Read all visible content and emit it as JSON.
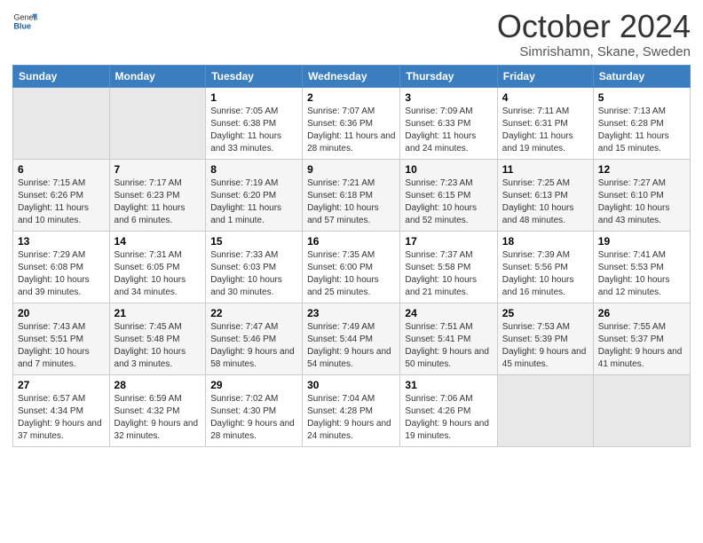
{
  "header": {
    "logo_line1": "General",
    "logo_line2": "Blue",
    "month": "October 2024",
    "location": "Simrishamn, Skane, Sweden"
  },
  "days_of_week": [
    "Sunday",
    "Monday",
    "Tuesday",
    "Wednesday",
    "Thursday",
    "Friday",
    "Saturday"
  ],
  "weeks": [
    [
      {
        "day": "",
        "sunrise": "",
        "sunset": "",
        "daylight": ""
      },
      {
        "day": "",
        "sunrise": "",
        "sunset": "",
        "daylight": ""
      },
      {
        "day": "1",
        "sunrise": "Sunrise: 7:05 AM",
        "sunset": "Sunset: 6:38 PM",
        "daylight": "Daylight: 11 hours and 33 minutes."
      },
      {
        "day": "2",
        "sunrise": "Sunrise: 7:07 AM",
        "sunset": "Sunset: 6:36 PM",
        "daylight": "Daylight: 11 hours and 28 minutes."
      },
      {
        "day": "3",
        "sunrise": "Sunrise: 7:09 AM",
        "sunset": "Sunset: 6:33 PM",
        "daylight": "Daylight: 11 hours and 24 minutes."
      },
      {
        "day": "4",
        "sunrise": "Sunrise: 7:11 AM",
        "sunset": "Sunset: 6:31 PM",
        "daylight": "Daylight: 11 hours and 19 minutes."
      },
      {
        "day": "5",
        "sunrise": "Sunrise: 7:13 AM",
        "sunset": "Sunset: 6:28 PM",
        "daylight": "Daylight: 11 hours and 15 minutes."
      }
    ],
    [
      {
        "day": "6",
        "sunrise": "Sunrise: 7:15 AM",
        "sunset": "Sunset: 6:26 PM",
        "daylight": "Daylight: 11 hours and 10 minutes."
      },
      {
        "day": "7",
        "sunrise": "Sunrise: 7:17 AM",
        "sunset": "Sunset: 6:23 PM",
        "daylight": "Daylight: 11 hours and 6 minutes."
      },
      {
        "day": "8",
        "sunrise": "Sunrise: 7:19 AM",
        "sunset": "Sunset: 6:20 PM",
        "daylight": "Daylight: 11 hours and 1 minute."
      },
      {
        "day": "9",
        "sunrise": "Sunrise: 7:21 AM",
        "sunset": "Sunset: 6:18 PM",
        "daylight": "Daylight: 10 hours and 57 minutes."
      },
      {
        "day": "10",
        "sunrise": "Sunrise: 7:23 AM",
        "sunset": "Sunset: 6:15 PM",
        "daylight": "Daylight: 10 hours and 52 minutes."
      },
      {
        "day": "11",
        "sunrise": "Sunrise: 7:25 AM",
        "sunset": "Sunset: 6:13 PM",
        "daylight": "Daylight: 10 hours and 48 minutes."
      },
      {
        "day": "12",
        "sunrise": "Sunrise: 7:27 AM",
        "sunset": "Sunset: 6:10 PM",
        "daylight": "Daylight: 10 hours and 43 minutes."
      }
    ],
    [
      {
        "day": "13",
        "sunrise": "Sunrise: 7:29 AM",
        "sunset": "Sunset: 6:08 PM",
        "daylight": "Daylight: 10 hours and 39 minutes."
      },
      {
        "day": "14",
        "sunrise": "Sunrise: 7:31 AM",
        "sunset": "Sunset: 6:05 PM",
        "daylight": "Daylight: 10 hours and 34 minutes."
      },
      {
        "day": "15",
        "sunrise": "Sunrise: 7:33 AM",
        "sunset": "Sunset: 6:03 PM",
        "daylight": "Daylight: 10 hours and 30 minutes."
      },
      {
        "day": "16",
        "sunrise": "Sunrise: 7:35 AM",
        "sunset": "Sunset: 6:00 PM",
        "daylight": "Daylight: 10 hours and 25 minutes."
      },
      {
        "day": "17",
        "sunrise": "Sunrise: 7:37 AM",
        "sunset": "Sunset: 5:58 PM",
        "daylight": "Daylight: 10 hours and 21 minutes."
      },
      {
        "day": "18",
        "sunrise": "Sunrise: 7:39 AM",
        "sunset": "Sunset: 5:56 PM",
        "daylight": "Daylight: 10 hours and 16 minutes."
      },
      {
        "day": "19",
        "sunrise": "Sunrise: 7:41 AM",
        "sunset": "Sunset: 5:53 PM",
        "daylight": "Daylight: 10 hours and 12 minutes."
      }
    ],
    [
      {
        "day": "20",
        "sunrise": "Sunrise: 7:43 AM",
        "sunset": "Sunset: 5:51 PM",
        "daylight": "Daylight: 10 hours and 7 minutes."
      },
      {
        "day": "21",
        "sunrise": "Sunrise: 7:45 AM",
        "sunset": "Sunset: 5:48 PM",
        "daylight": "Daylight: 10 hours and 3 minutes."
      },
      {
        "day": "22",
        "sunrise": "Sunrise: 7:47 AM",
        "sunset": "Sunset: 5:46 PM",
        "daylight": "Daylight: 9 hours and 58 minutes."
      },
      {
        "day": "23",
        "sunrise": "Sunrise: 7:49 AM",
        "sunset": "Sunset: 5:44 PM",
        "daylight": "Daylight: 9 hours and 54 minutes."
      },
      {
        "day": "24",
        "sunrise": "Sunrise: 7:51 AM",
        "sunset": "Sunset: 5:41 PM",
        "daylight": "Daylight: 9 hours and 50 minutes."
      },
      {
        "day": "25",
        "sunrise": "Sunrise: 7:53 AM",
        "sunset": "Sunset: 5:39 PM",
        "daylight": "Daylight: 9 hours and 45 minutes."
      },
      {
        "day": "26",
        "sunrise": "Sunrise: 7:55 AM",
        "sunset": "Sunset: 5:37 PM",
        "daylight": "Daylight: 9 hours and 41 minutes."
      }
    ],
    [
      {
        "day": "27",
        "sunrise": "Sunrise: 6:57 AM",
        "sunset": "Sunset: 4:34 PM",
        "daylight": "Daylight: 9 hours and 37 minutes."
      },
      {
        "day": "28",
        "sunrise": "Sunrise: 6:59 AM",
        "sunset": "Sunset: 4:32 PM",
        "daylight": "Daylight: 9 hours and 32 minutes."
      },
      {
        "day": "29",
        "sunrise": "Sunrise: 7:02 AM",
        "sunset": "Sunset: 4:30 PM",
        "daylight": "Daylight: 9 hours and 28 minutes."
      },
      {
        "day": "30",
        "sunrise": "Sunrise: 7:04 AM",
        "sunset": "Sunset: 4:28 PM",
        "daylight": "Daylight: 9 hours and 24 minutes."
      },
      {
        "day": "31",
        "sunrise": "Sunrise: 7:06 AM",
        "sunset": "Sunset: 4:26 PM",
        "daylight": "Daylight: 9 hours and 19 minutes."
      },
      {
        "day": "",
        "sunrise": "",
        "sunset": "",
        "daylight": ""
      },
      {
        "day": "",
        "sunrise": "",
        "sunset": "",
        "daylight": ""
      }
    ]
  ]
}
